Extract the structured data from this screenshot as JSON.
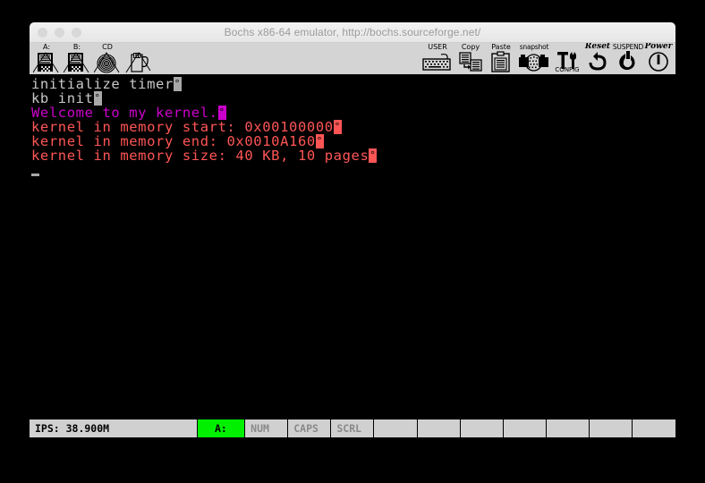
{
  "window": {
    "title": "Bochs x86-64 emulator, http://bochs.sourceforge.net/",
    "traffic_lights": [
      "close",
      "minimize",
      "maximize"
    ]
  },
  "toolbar": {
    "left_buttons": [
      {
        "label": "A:",
        "icon": "floppy-a-icon",
        "disabled": true
      },
      {
        "label": "B:",
        "icon": "floppy-b-icon",
        "disabled": true
      },
      {
        "label": "CD",
        "icon": "cdrom-icon",
        "disabled": true
      },
      {
        "label": "",
        "icon": "usb-icon",
        "disabled": true
      }
    ],
    "right_buttons": [
      {
        "label": "USER",
        "icon": "keyboard-icon"
      },
      {
        "label": "Copy",
        "icon": "copy-icon"
      },
      {
        "label": "Paste",
        "icon": "paste-icon"
      },
      {
        "label": "snapshot",
        "icon": "camera-icon"
      },
      {
        "label": "CONFIG",
        "icon": "wrench-tools-icon"
      },
      {
        "label": "Reset",
        "icon": "reset-arrow-icon"
      },
      {
        "label": "SUSPEND",
        "icon": "suspend-power-icon"
      },
      {
        "label": "Power",
        "icon": "power-circle-icon"
      }
    ]
  },
  "screen": {
    "lines": [
      {
        "text": "initialize timer",
        "color": "white",
        "trailing_null": "gray"
      },
      {
        "text": "kb init",
        "color": "white",
        "trailing_null": "gray"
      },
      {
        "text": "Welcome to my kernel.",
        "color": "magenta",
        "trailing_null": "magenta"
      },
      {
        "text": "kernel in memory start: 0x00100000",
        "color": "red",
        "trailing_null": "red"
      },
      {
        "text": "kernel in memory end: 0x0010A160",
        "color": "red",
        "trailing_null": "red"
      },
      {
        "text": "kernel in memory size: 40 KB, 10 pages",
        "color": "red",
        "trailing_null": "red"
      }
    ],
    "null_glyph": "°",
    "cursor": "_",
    "colors": {
      "white": "#c8c8c8",
      "magenta": "#cc00cc",
      "red": "#ff5555",
      "background": "#000000"
    }
  },
  "status_bar": {
    "ips": "IPS: 38.900M",
    "floppy": "A:",
    "floppy_color": "#00f000",
    "indicators": [
      "NUM",
      "CAPS",
      "SCRL"
    ],
    "blank_cells": 7
  }
}
